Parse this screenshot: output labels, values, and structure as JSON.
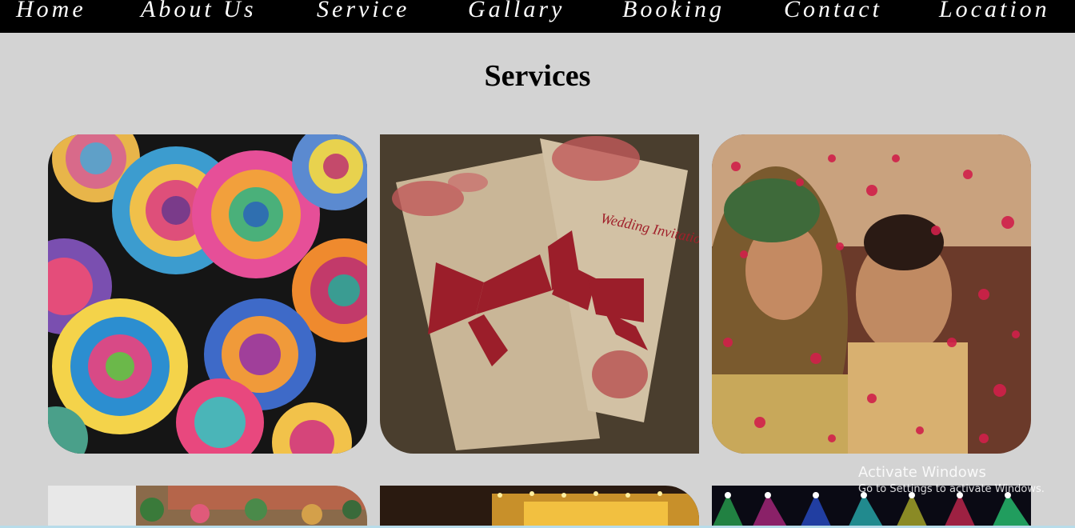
{
  "nav": {
    "items": [
      {
        "label": "Home"
      },
      {
        "label": "About Us"
      },
      {
        "label": "Service"
      },
      {
        "label": "Gallary"
      },
      {
        "label": "Booking"
      },
      {
        "label": "Contact"
      },
      {
        "label": "Location"
      }
    ]
  },
  "page": {
    "title": "Services"
  },
  "cards": [
    {
      "subject": "rainbow roses bouquet"
    },
    {
      "subject": "wedding invitation cards",
      "print_text": "Wedding Invitation"
    },
    {
      "subject": "bride and groom flower petal shower"
    },
    {
      "subject": "floral table decoration"
    },
    {
      "subject": "illuminated venue at night"
    },
    {
      "subject": "colorful stage lights"
    }
  ],
  "watermark": {
    "title": "Activate Windows",
    "subtitle": "Go to Settings to activate Windows."
  },
  "colors": {
    "nav_bg": "#000000",
    "page_bg": "#d3d3d3",
    "nav_text": "#ffffff"
  }
}
